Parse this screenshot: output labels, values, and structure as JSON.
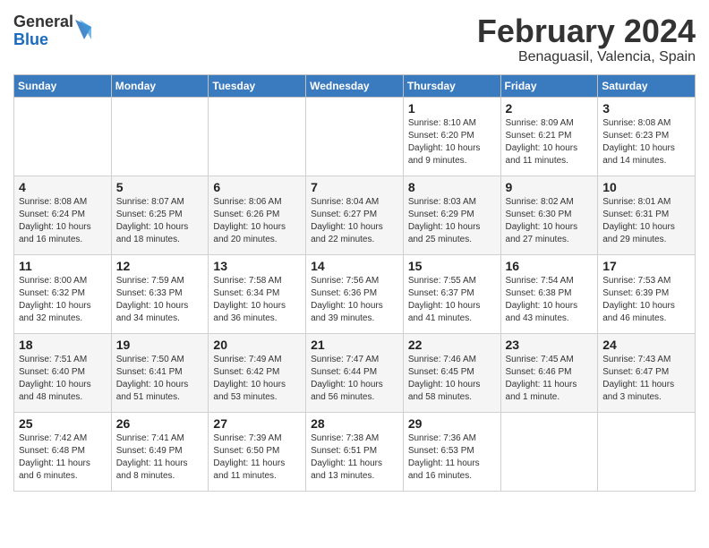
{
  "header": {
    "logo_general": "General",
    "logo_blue": "Blue",
    "month": "February 2024",
    "location": "Benaguasil, Valencia, Spain"
  },
  "days_of_week": [
    "Sunday",
    "Monday",
    "Tuesday",
    "Wednesday",
    "Thursday",
    "Friday",
    "Saturday"
  ],
  "weeks": [
    [
      {
        "num": "",
        "info": ""
      },
      {
        "num": "",
        "info": ""
      },
      {
        "num": "",
        "info": ""
      },
      {
        "num": "",
        "info": ""
      },
      {
        "num": "1",
        "info": "Sunrise: 8:10 AM\nSunset: 6:20 PM\nDaylight: 10 hours\nand 9 minutes."
      },
      {
        "num": "2",
        "info": "Sunrise: 8:09 AM\nSunset: 6:21 PM\nDaylight: 10 hours\nand 11 minutes."
      },
      {
        "num": "3",
        "info": "Sunrise: 8:08 AM\nSunset: 6:23 PM\nDaylight: 10 hours\nand 14 minutes."
      }
    ],
    [
      {
        "num": "4",
        "info": "Sunrise: 8:08 AM\nSunset: 6:24 PM\nDaylight: 10 hours\nand 16 minutes."
      },
      {
        "num": "5",
        "info": "Sunrise: 8:07 AM\nSunset: 6:25 PM\nDaylight: 10 hours\nand 18 minutes."
      },
      {
        "num": "6",
        "info": "Sunrise: 8:06 AM\nSunset: 6:26 PM\nDaylight: 10 hours\nand 20 minutes."
      },
      {
        "num": "7",
        "info": "Sunrise: 8:04 AM\nSunset: 6:27 PM\nDaylight: 10 hours\nand 22 minutes."
      },
      {
        "num": "8",
        "info": "Sunrise: 8:03 AM\nSunset: 6:29 PM\nDaylight: 10 hours\nand 25 minutes."
      },
      {
        "num": "9",
        "info": "Sunrise: 8:02 AM\nSunset: 6:30 PM\nDaylight: 10 hours\nand 27 minutes."
      },
      {
        "num": "10",
        "info": "Sunrise: 8:01 AM\nSunset: 6:31 PM\nDaylight: 10 hours\nand 29 minutes."
      }
    ],
    [
      {
        "num": "11",
        "info": "Sunrise: 8:00 AM\nSunset: 6:32 PM\nDaylight: 10 hours\nand 32 minutes."
      },
      {
        "num": "12",
        "info": "Sunrise: 7:59 AM\nSunset: 6:33 PM\nDaylight: 10 hours\nand 34 minutes."
      },
      {
        "num": "13",
        "info": "Sunrise: 7:58 AM\nSunset: 6:34 PM\nDaylight: 10 hours\nand 36 minutes."
      },
      {
        "num": "14",
        "info": "Sunrise: 7:56 AM\nSunset: 6:36 PM\nDaylight: 10 hours\nand 39 minutes."
      },
      {
        "num": "15",
        "info": "Sunrise: 7:55 AM\nSunset: 6:37 PM\nDaylight: 10 hours\nand 41 minutes."
      },
      {
        "num": "16",
        "info": "Sunrise: 7:54 AM\nSunset: 6:38 PM\nDaylight: 10 hours\nand 43 minutes."
      },
      {
        "num": "17",
        "info": "Sunrise: 7:53 AM\nSunset: 6:39 PM\nDaylight: 10 hours\nand 46 minutes."
      }
    ],
    [
      {
        "num": "18",
        "info": "Sunrise: 7:51 AM\nSunset: 6:40 PM\nDaylight: 10 hours\nand 48 minutes."
      },
      {
        "num": "19",
        "info": "Sunrise: 7:50 AM\nSunset: 6:41 PM\nDaylight: 10 hours\nand 51 minutes."
      },
      {
        "num": "20",
        "info": "Sunrise: 7:49 AM\nSunset: 6:42 PM\nDaylight: 10 hours\nand 53 minutes."
      },
      {
        "num": "21",
        "info": "Sunrise: 7:47 AM\nSunset: 6:44 PM\nDaylight: 10 hours\nand 56 minutes."
      },
      {
        "num": "22",
        "info": "Sunrise: 7:46 AM\nSunset: 6:45 PM\nDaylight: 10 hours\nand 58 minutes."
      },
      {
        "num": "23",
        "info": "Sunrise: 7:45 AM\nSunset: 6:46 PM\nDaylight: 11 hours\nand 1 minute."
      },
      {
        "num": "24",
        "info": "Sunrise: 7:43 AM\nSunset: 6:47 PM\nDaylight: 11 hours\nand 3 minutes."
      }
    ],
    [
      {
        "num": "25",
        "info": "Sunrise: 7:42 AM\nSunset: 6:48 PM\nDaylight: 11 hours\nand 6 minutes."
      },
      {
        "num": "26",
        "info": "Sunrise: 7:41 AM\nSunset: 6:49 PM\nDaylight: 11 hours\nand 8 minutes."
      },
      {
        "num": "27",
        "info": "Sunrise: 7:39 AM\nSunset: 6:50 PM\nDaylight: 11 hours\nand 11 minutes."
      },
      {
        "num": "28",
        "info": "Sunrise: 7:38 AM\nSunset: 6:51 PM\nDaylight: 11 hours\nand 13 minutes."
      },
      {
        "num": "29",
        "info": "Sunrise: 7:36 AM\nSunset: 6:53 PM\nDaylight: 11 hours\nand 16 minutes."
      },
      {
        "num": "",
        "info": ""
      },
      {
        "num": "",
        "info": ""
      }
    ]
  ]
}
